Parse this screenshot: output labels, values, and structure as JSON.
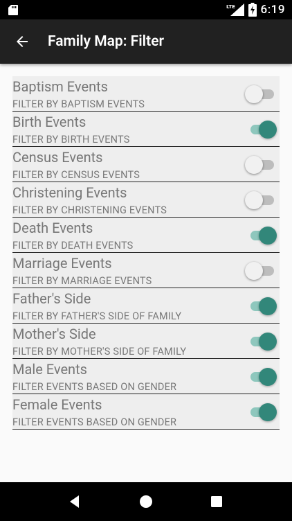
{
  "status_bar": {
    "network_label": "LTE",
    "time": "6:19"
  },
  "app_bar": {
    "title": "Family Map: Filter",
    "back_icon": "arrow-back-icon"
  },
  "filters": [
    {
      "title": "Baptism Events",
      "subtitle": "FILTER BY BAPTISM EVENTS",
      "enabled": false
    },
    {
      "title": "Birth Events",
      "subtitle": "FILTER BY BIRTH EVENTS",
      "enabled": true
    },
    {
      "title": "Census Events",
      "subtitle": "FILTER BY CENSUS EVENTS",
      "enabled": false
    },
    {
      "title": "Christening Events",
      "subtitle": "FILTER BY CHRISTENING EVENTS",
      "enabled": false
    },
    {
      "title": "Death Events",
      "subtitle": "FILTER BY DEATH EVENTS",
      "enabled": true
    },
    {
      "title": "Marriage Events",
      "subtitle": "FILTER BY MARRIAGE EVENTS",
      "enabled": false
    },
    {
      "title": "Father's Side",
      "subtitle": "FILTER BY FATHER'S SIDE OF FAMILY",
      "enabled": true
    },
    {
      "title": "Mother's Side",
      "subtitle": "FILTER BY MOTHER'S SIDE OF FAMILY",
      "enabled": true
    },
    {
      "title": "Male Events",
      "subtitle": "FILTER EVENTS BASED ON GENDER",
      "enabled": true
    },
    {
      "title": "Female Events",
      "subtitle": "FILTER EVENTS BASED ON GENDER",
      "enabled": true
    }
  ],
  "colors": {
    "switch_on_thumb": "#32877a",
    "switch_on_track": "#8ec7bd",
    "switch_off_thumb": "#f1f1f1",
    "switch_off_track": "#bdbdbd",
    "app_bar": "#212121"
  },
  "nav_bar": {
    "icons": [
      "back-triangle-icon",
      "home-circle-icon",
      "recents-square-icon"
    ]
  }
}
